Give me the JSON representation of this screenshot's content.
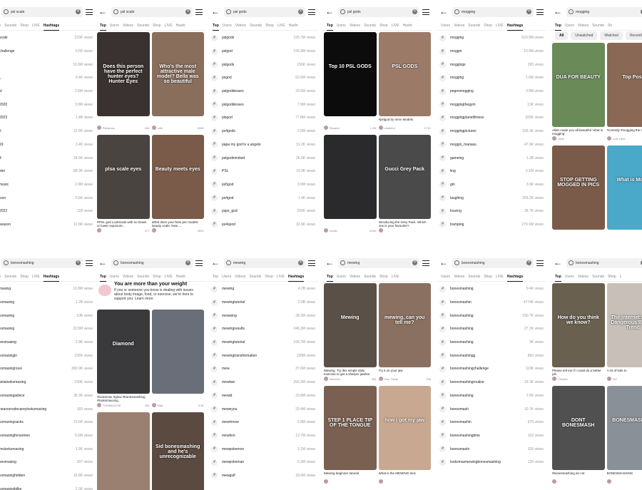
{
  "panels": [
    {
      "query": "psl scale",
      "tabs": [
        "Videos",
        "Sounds",
        "Shop",
        "LIVE",
        "Hashtags"
      ],
      "active": 4,
      "partial": true,
      "rows": [
        [
          "scale",
          "223K views"
        ],
        [
          "challenge",
          "5.6K views"
        ],
        [
          "",
          "10.3M views"
        ],
        [
          "_",
          "9.4K views"
        ],
        [
          "sl",
          "2.6M views"
        ],
        [
          "2020",
          "3.9M views"
        ],
        [
          "2023",
          "1.4B views"
        ],
        [
          "5",
          "22.6K views"
        ],
        [
          "19",
          "2.4K views"
        ],
        [
          "4",
          "34.5K views"
        ],
        [
          "ster",
          "88.3K views"
        ],
        [
          "music",
          "2.9M views"
        ],
        [
          "ison",
          "5.6K views"
        ],
        [
          "2022",
          "118 views"
        ],
        [
          "season",
          "12.8K views"
        ]
      ]
    },
    {
      "query": "psl scale",
      "tabs": [
        "Top",
        "Users",
        "Videos",
        "Sounds",
        "Shop",
        "LIVE",
        "Hasht"
      ],
      "active": 0,
      "cards": [
        {
          "label": "Does this person have the perfect hunter eyes? Hunter Eyes",
          "title": "",
          "user": "Rubymus",
          "likes": "18K",
          "color": "#3a3230"
        },
        {
          "label": "Who's the most attractive male model? Bella was so beautiful",
          "title": "",
          "user": "rolls",
          "likes": "528K",
          "color": "#8a6e5c"
        },
        {
          "label": "plsa scale eyes",
          "title": "#PSL god Lookscale with no Down or lower exposure...",
          "user": "",
          "likes": "477",
          "color": "#4a4440"
        },
        {
          "label": "Beauty meets eyes",
          "title": "What does your New per models beauty scale. New ...",
          "user": "",
          "likes": "452K",
          "color": "#7a5a48"
        }
      ]
    },
    {
      "query": "psl gods",
      "tabs": [
        "Top",
        "Users",
        "Videos",
        "Sounds",
        "Shop",
        "LIVE",
        "Hasht"
      ],
      "active": 0,
      "rows": [
        [
          "pslgods",
          "105.7M views"
        ],
        [
          "pslgod",
          "155.9M views"
        ],
        [
          "pslgods",
          "156K views"
        ],
        [
          "psgod",
          "52.6M views"
        ],
        [
          "pslgoddesses",
          "33.5M views"
        ],
        [
          "pslgoddesses",
          "7.9M views"
        ],
        [
          "plsgod",
          "77.8M views"
        ],
        [
          "ps4gods",
          "2.8M views"
        ],
        [
          "papa my god tv u angels",
          "31.2K views"
        ],
        [
          "pslgodmindset",
          "26.5K views"
        ],
        [
          "PSL",
          "19.9K views"
        ],
        [
          "ps5god",
          "3.9M views"
        ],
        [
          "ps4god",
          "1.4K views"
        ],
        [
          "psps_god",
          "256K views"
        ],
        [
          "ps4spod",
          "32.6K views"
        ]
      ]
    },
    {
      "query": "psl gods",
      "tabs": [
        "Top",
        "Users",
        "Videos",
        "Sounds",
        "Shop",
        "LIVE",
        "Hasht"
      ],
      "active": 0,
      "cards": [
        {
          "label": "Top 10 PSL GODS",
          "title": "",
          "user": "Rosario",
          "likes": "1.2M",
          "color": "#0c0c0c"
        },
        {
          "label": "PSL GODS",
          "title": "#pslgod by mmv Models",
          "user": "modelmi",
          "likes": "171K",
          "color": "#9b7a68"
        },
        {
          "label": "",
          "title": "",
          "user": "model",
          "likes": "424K",
          "color": "#2a2a2c"
        },
        {
          "label": "Gucci Grey Pack",
          "title": "Introducing the Grey Pack. Which one is your favourite?",
          "user": "",
          "likes": "",
          "color": "#4b4a4a"
        }
      ]
    },
    {
      "query": "mogging",
      "tabs": [
        "Users",
        "Videos",
        "Sounds",
        "Shop",
        "LIVE",
        "Hashtags"
      ],
      "active": 5,
      "rows": [
        [
          "mogging",
          "620.9M views"
        ],
        [
          "moggin",
          "10.9M views"
        ],
        [
          "moggings",
          "265 views"
        ],
        [
          "mogging",
          "1.6M views"
        ],
        [
          "pegesmogging",
          "3.9M views"
        ],
        [
          "moggingthegym",
          "13K views"
        ],
        [
          "moggingplanetfitness",
          "305K views"
        ],
        [
          "moggingpictures",
          "166.3K views"
        ],
        [
          "moggin_manasu",
          "47.9K views"
        ],
        [
          "gameing",
          "1.3B views"
        ],
        [
          "ling",
          "2.1M views"
        ],
        [
          "gin",
          "3.9K views"
        ],
        [
          "laughing",
          "265.2K views"
        ],
        [
          "loucing",
          "36.7K views"
        ],
        [
          "tramping",
          "270.1M views"
        ]
      ]
    },
    {
      "query": "mogging",
      "tabs": [
        "Top",
        "Users",
        "Videos",
        "Sounds",
        "Sh"
      ],
      "active": 0,
      "chips": [
        "All",
        "Unwatched",
        "Watched",
        "Recently"
      ],
      "cards": [
        {
          "label": "DUA FOR BEAUTY",
          "title": "Allah made you all beautiful 'what is mogging'",
          "user": "Dewi",
          "likes": "",
          "color": "#6a8a58"
        },
        {
          "label": "Top Post",
          "title": "#comedy #mogging the cutest skit",
          "user": "Cole Herd",
          "likes": "",
          "color": "#8a6856"
        },
        {
          "label": "STOP GETTING MOGGED IN PICS",
          "title": "",
          "user": "",
          "likes": "",
          "color": "#7a5a48"
        },
        {
          "label": "What is Mogg",
          "title": "",
          "user": "",
          "likes": "",
          "color": "#4aa8c8"
        }
      ]
    },
    {
      "query": "bonesmashing",
      "tabs": [
        "Videos",
        "Sounds",
        "Shop",
        "LIVE",
        "Hashtags"
      ],
      "active": 4,
      "partial": true,
      "rows": [
        [
          "masing",
          "10.9M views"
        ],
        [
          "ksmasing",
          "1.2B views"
        ],
        [
          "ksmasing",
          "10B views"
        ],
        [
          "ksmasing",
          "22.5M views"
        ],
        [
          "sesmasing",
          "2.8K views"
        ],
        [
          "ksmasingin",
          "106K views"
        ],
        [
          "ksmasingrossi",
          "360.9K views"
        ],
        [
          "anialooksmaxing",
          "100K views"
        ],
        [
          "ksmasingadvice",
          "36.3K views"
        ],
        [
          "nearsonsdecareylooksmaxing",
          "165 views"
        ],
        [
          "ksmaxingsacks",
          "10.6K views"
        ],
        [
          "ksmasingforwomen",
          "5.6M views"
        ],
        [
          "mslooksmaxing",
          "1.5K views"
        ],
        [
          "sesmasing",
          "307 views"
        ],
        [
          "ksmasinghidden",
          "16.8K views"
        ],
        [
          "ksmasingbilke",
          "2.3K views"
        ]
      ]
    },
    {
      "query": "bonesmashing",
      "tabs": [
        "Top",
        "Users",
        "Videos",
        "Sounds",
        "Shop",
        "LIVE",
        "Hasht"
      ],
      "active": 0,
      "banner": {
        "title": "You are more than your weight",
        "text": "If you or someone you know is dealing with issues about body image, food, or exercise, we're here to support you. Learn more"
      },
      "cards": [
        {
          "label": "Diamond",
          "title": "#looksmax #glow #bonesmashing #looksmaxxing",
          "user": "TOMMAZZOE",
          "likes": "285",
          "color": "#3a3a3c"
        },
        {
          "label": "",
          "title": "",
          "user": "Mike",
          "likes": "9.3K",
          "color": "#6a6e78"
        },
        {
          "label": "",
          "title": "",
          "user": "",
          "likes": "",
          "color": "#9a8070"
        },
        {
          "label": "Sid bonesmashing and he's unrecognizable",
          "title": "",
          "user": "",
          "likes": "",
          "color": "#5a4a40"
        }
      ]
    },
    {
      "query": "mewing",
      "tabs": [
        "Top",
        "Users",
        "Videos",
        "Sounds",
        "Shop",
        "LIVE",
        "Hashtags"
      ],
      "active": 6,
      "rows": [
        [
          "mewing",
          "4.2B views"
        ],
        [
          "mewingtutorial",
          "2.9B views"
        ],
        [
          "mewwing",
          "28.2M views"
        ],
        [
          "mewingresults",
          "346.3M views"
        ],
        [
          "mewingtutorial",
          "169.7M views"
        ],
        [
          "mewingtransformation",
          "128M views"
        ],
        [
          "mew",
          "37.6M views"
        ],
        [
          "mewtwo",
          "250.2M views"
        ],
        [
          "mewid",
          "23.8M views"
        ],
        [
          "meweyou",
          "23.4M views"
        ],
        [
          "mewinnow",
          "2.8M views"
        ],
        [
          "mewtion",
          "13.7M views"
        ],
        [
          "mewpokemon",
          "2.1M views"
        ],
        [
          "mewpokeman",
          "6.2M views"
        ],
        [
          "mewgulf",
          "18.6M views"
        ]
      ]
    },
    {
      "query": "mewing",
      "tabs": [
        "Top",
        "Users",
        "Videos",
        "Sounds",
        "Shop",
        "LIVE"
      ],
      "active": 0,
      "cards": [
        {
          "label": "Mewing",
          "title": "Mewing. Try this simple daily exercise to get a sharper jawline",
          "user": "Mauricio",
          "likes": "264",
          "color": "#5a5048"
        },
        {
          "label": "mewing, can you tell me?",
          "title": "Try it on your jaw",
          "user": "Your Tiktok",
          "likes": "256",
          "color": "#8a7060"
        },
        {
          "label": "STEP 1 PLACE TIP OF THE TONGUE",
          "title": "Mewing beginner tutorial",
          "user": "",
          "likes": "",
          "color": "#7a6050"
        },
        {
          "label": "how i got my jaw",
          "title": "What is the MEWING trick",
          "user": "",
          "likes": "",
          "color": "#c8a890"
        }
      ]
    },
    {
      "query": "bonesmashing",
      "tabs": [
        "Users",
        "Videos",
        "Sounds",
        "Shop",
        "LIVE",
        "Hashtags"
      ],
      "active": 5,
      "rows": [
        [
          "bonesmashing",
          "9.4K views"
        ],
        [
          "bonesmashin",
          "4774K views"
        ],
        [
          "bonesmashing",
          "230.7K views"
        ],
        [
          "bonesmashing",
          "27.2K views"
        ],
        [
          "bonesmaching",
          "3K views"
        ],
        [
          "bonesmashingg",
          "860 views"
        ],
        [
          "bonesmashingchallenge",
          "113K views"
        ],
        [
          "bonesmashingroutine",
          "19.3K views"
        ],
        [
          "bonesmashing",
          "2.6K views"
        ],
        [
          "bonesmash",
          "10.7K views"
        ],
        [
          "bonesmashin",
          "670 views"
        ],
        [
          "bonesmashingtime",
          "102 views"
        ],
        [
          "bonesmashi",
          "326 views"
        ],
        [
          "looksmaxmewingbonesmashing",
          "135 views"
        ]
      ]
    },
    {
      "query": "bonesmashing",
      "tabs": [
        "Top",
        "Users",
        "Videos",
        "Sounds",
        "Shop",
        "L"
      ],
      "active": 0,
      "cards": [
        {
          "label": "How do you think we know?",
          "title": "Please tell me if i could do a better job",
          "user": "Charles",
          "likes": "",
          "color": "#6a6050"
        },
        {
          "label": "The internet's new Dangerous Beauty Trend",
          "title": "A lot of kids to",
          "user": "VIC",
          "likes": "",
          "color": "#c8c0b8"
        },
        {
          "label": "DONT BONESMASH",
          "title": "#bonesmashing do not",
          "user": "",
          "likes": "",
          "color": "#505050"
        },
        {
          "label": "BONESMASHING",
          "title": "BONESMASHING",
          "user": "",
          "likes": "",
          "color": "#8a9098"
        }
      ]
    }
  ]
}
